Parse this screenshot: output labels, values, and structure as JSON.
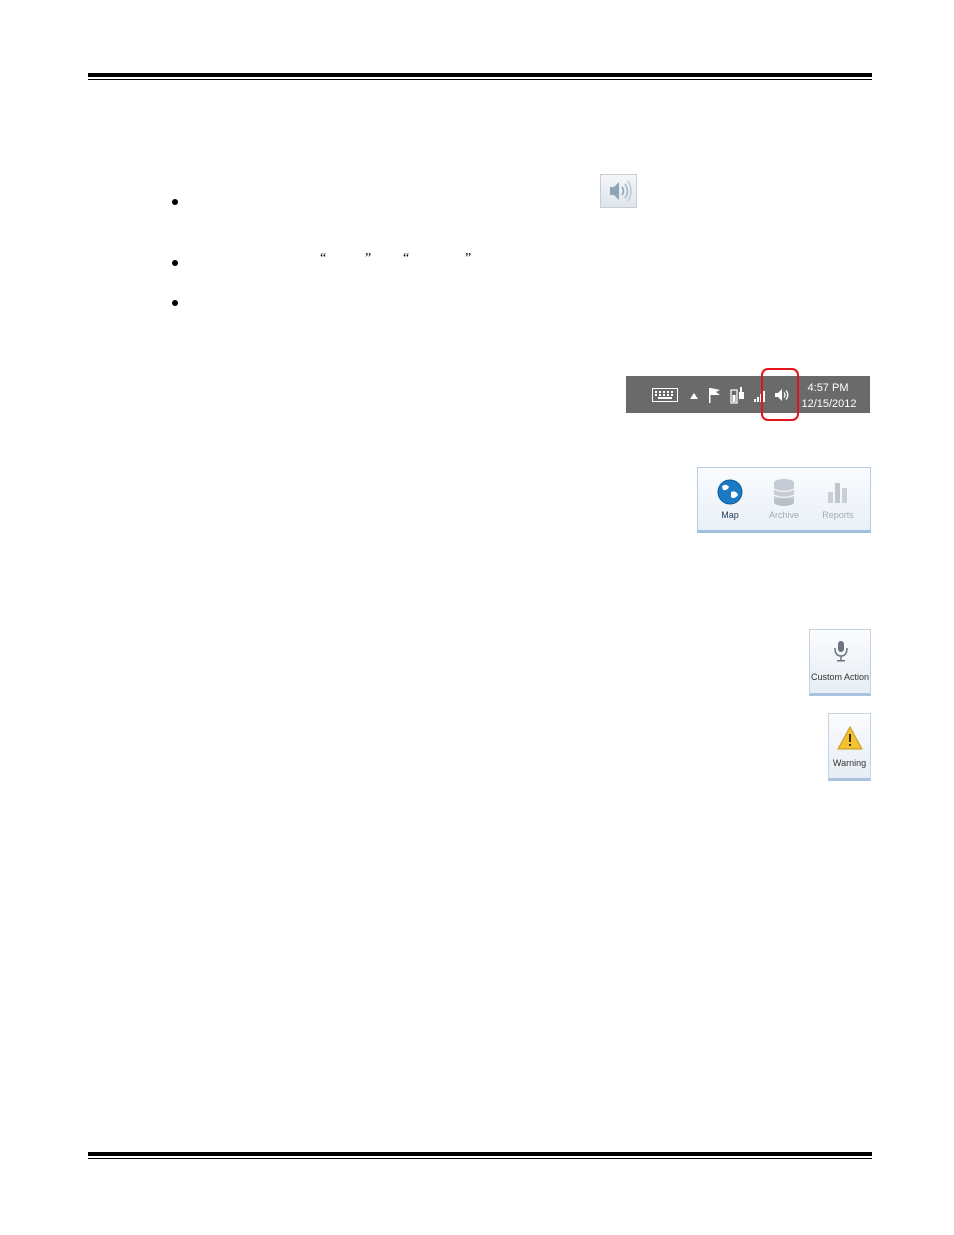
{
  "quotes": [
    "“",
    "”",
    "“",
    "”"
  ],
  "taskbar": {
    "time": "4:57 PM",
    "date": "12/15/2012",
    "icons": [
      "keyboard-icon",
      "show-hidden-icons-icon",
      "action-center-flag-icon",
      "power-icon",
      "signal-bars-icon",
      "speaker-icon"
    ]
  },
  "ribbon": {
    "buttons": [
      {
        "label": "Map",
        "icon": "globe-icon",
        "enabled": true
      },
      {
        "label": "Archive",
        "icon": "database-icon",
        "enabled": false
      },
      {
        "label": "Reports",
        "icon": "bar-chart-icon",
        "enabled": false
      }
    ]
  },
  "tiles": {
    "custom_action": {
      "label": "Custom Action",
      "icon": "microphone-icon"
    },
    "warning": {
      "label": "Warning",
      "icon": "warning-triangle-icon"
    }
  },
  "colors": {
    "highlight": "#e3151a",
    "taskbar": "#6a6a6a",
    "globe": "#1a7bc4",
    "warning": "#f2c230"
  }
}
